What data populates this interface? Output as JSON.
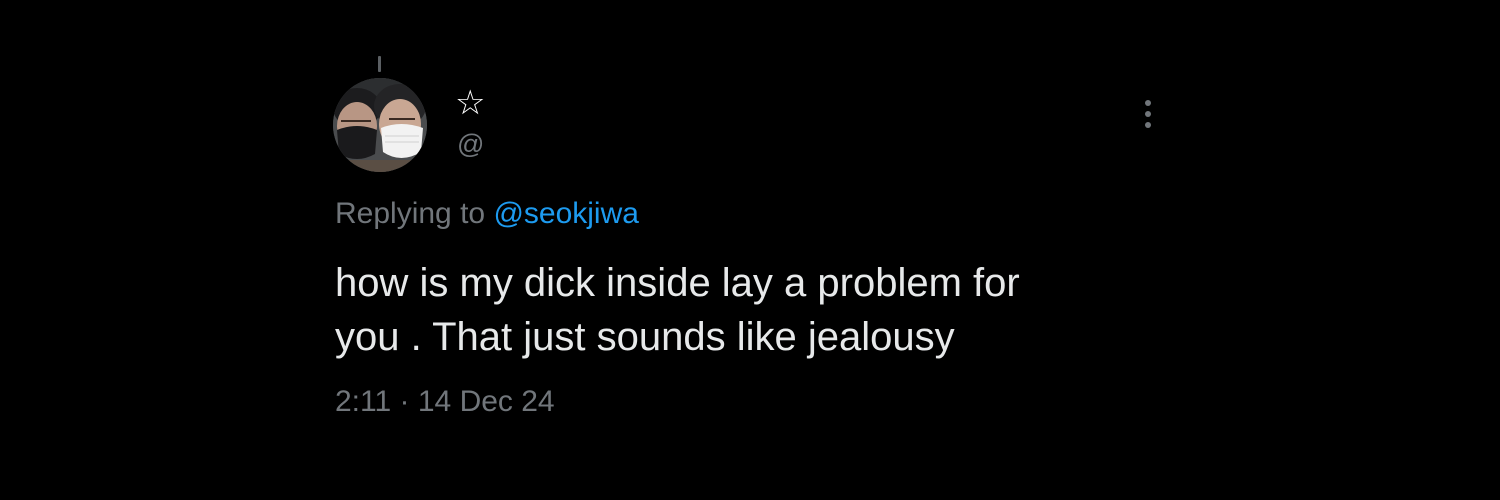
{
  "tweet": {
    "display_name": "☆",
    "handle": "@",
    "more_icon": "more-vertical-icon",
    "reply_prefix": "Replying to",
    "reply_mention": "@seokjiwa",
    "text_lines": [
      "how is my dick inside lay a problem for",
      "you . That just sounds like jealousy"
    ],
    "time": "2:11",
    "separator": "·",
    "date": "14 Dec 24"
  },
  "colors": {
    "background": "#000000",
    "primary_text": "#e7e9ea",
    "secondary_text": "#71767b",
    "link": "#1d9bf0"
  }
}
